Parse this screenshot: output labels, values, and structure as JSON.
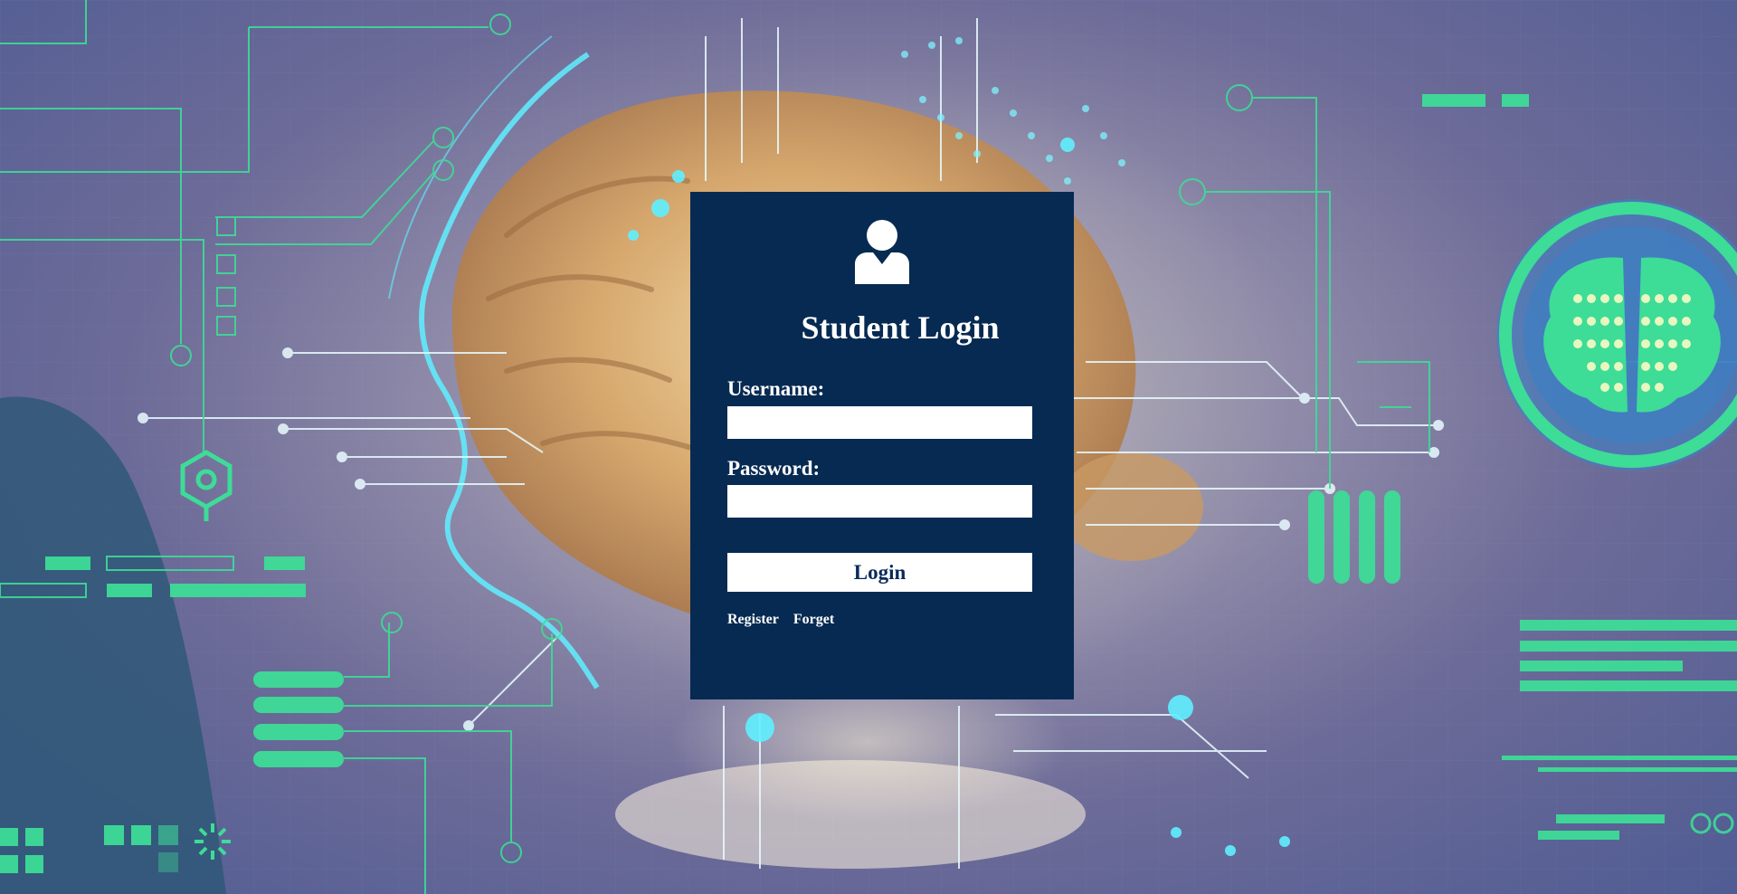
{
  "login": {
    "title": "Student Login",
    "username_label": "Username:",
    "username_value": "",
    "password_label": "Password:",
    "password_value": "",
    "login_button": "Login",
    "links": {
      "register": "Register",
      "forget": "Forget"
    }
  },
  "colors": {
    "card_background": "#062a52",
    "button_text": "#0a2a5a",
    "circuit_green": "#3ddc97",
    "circuit_cyan": "#5ff0ff"
  },
  "icons": {
    "avatar": "user-icon"
  }
}
